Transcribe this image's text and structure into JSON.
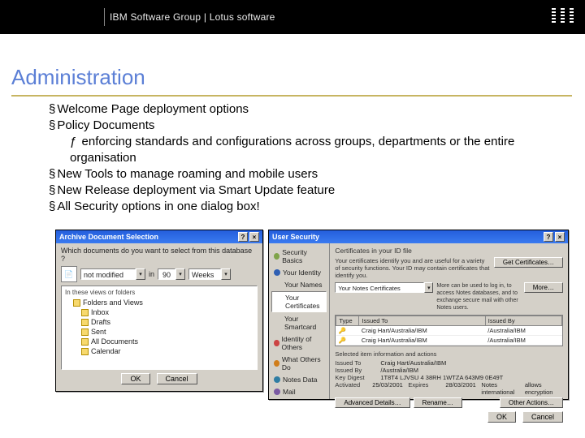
{
  "header": {
    "title": "IBM Software Group  |  Lotus software",
    "logo_alt": "IBM"
  },
  "section_title": "Administration",
  "bullets": {
    "b1": "Welcome Page deployment options",
    "b2": "Policy Documents",
    "b2_sub": "enforcing standards and configurations across groups, departments or the entire organisation",
    "b3": "New Tools to manage roaming and mobile users",
    "b4": "New Release deployment via Smart Update feature",
    "b5": "All Security options in one dialog box!"
  },
  "dlg1": {
    "title": "Archive Document Selection",
    "question": "Which documents do you want to select from this database ?",
    "combo1_label": "not modified",
    "combo2_label": "in",
    "combo3_value": "90",
    "combo3_unit": "Weeks",
    "tree_hdr": "In these views or folders",
    "tree_root": "Folders and Views",
    "tree_items": [
      "Inbox",
      "Drafts",
      "Sent",
      "All Documents",
      "Calendar"
    ],
    "ok": "OK",
    "cancel": "Cancel"
  },
  "dlg2": {
    "title": "User Security",
    "group_title": "Certificates in your ID file",
    "desc": "Your certificates identify you and are useful for a variety of security functions. Your ID may contain certificates that identify you.",
    "side_items": [
      {
        "label": "Security Basics",
        "color": "#7fa34a"
      },
      {
        "label": "Your Identity",
        "color": "#2f5fb3"
      },
      {
        "label": "Your Names",
        "color": ""
      },
      {
        "label": "Your Certificates",
        "color": ""
      },
      {
        "label": "Your Smartcard",
        "color": ""
      },
      {
        "label": "Identity of Others",
        "color": "#c44"
      },
      {
        "label": "What Others Do",
        "color": "#d07d1a"
      },
      {
        "label": "Notes Data",
        "color": "#2f7da3"
      },
      {
        "label": "Mail",
        "color": "#7a5aa3"
      }
    ],
    "cert_dropdown": "Your Notes Certificates",
    "more_hint": "More can be used to log in, to access Notes databases, and to exchange secure mail with other Notes users.",
    "grid": {
      "col1": "Type",
      "col2": "Issued To",
      "col3": "Issued By",
      "rows": [
        {
          "to": "Craig Hart/Australia/IBM",
          "by": "/Australia/IBM"
        },
        {
          "to": "Craig Hart/Australia/IBM",
          "by": "/Australia/IBM"
        }
      ]
    },
    "info_header": "Selected item information and actions",
    "info": {
      "issued_to_k": "Issued To",
      "issued_to_v": "Craig Hart/Australia/IBM",
      "issued_by_k": "Issued By",
      "issued_by_v": "/Australia/IBM",
      "digest_k": "Key Digest",
      "digest_v": "1T8T4 LJVSU 4 38RH 1WTZA 643M9 0E49T",
      "activated_k": "Activated",
      "activated_v": "25/03/2001",
      "last_k": "Expires",
      "last_v": "28/03/2001",
      "int_k": "Notes international",
      "int_v": "allows encryption"
    },
    "buttons": {
      "get": "Get Certificates…",
      "more": "More…",
      "adv": "Advanced Details…",
      "rename": "Rename…",
      "other": "Other Actions…",
      "ok": "OK",
      "cancel": "Cancel"
    }
  }
}
